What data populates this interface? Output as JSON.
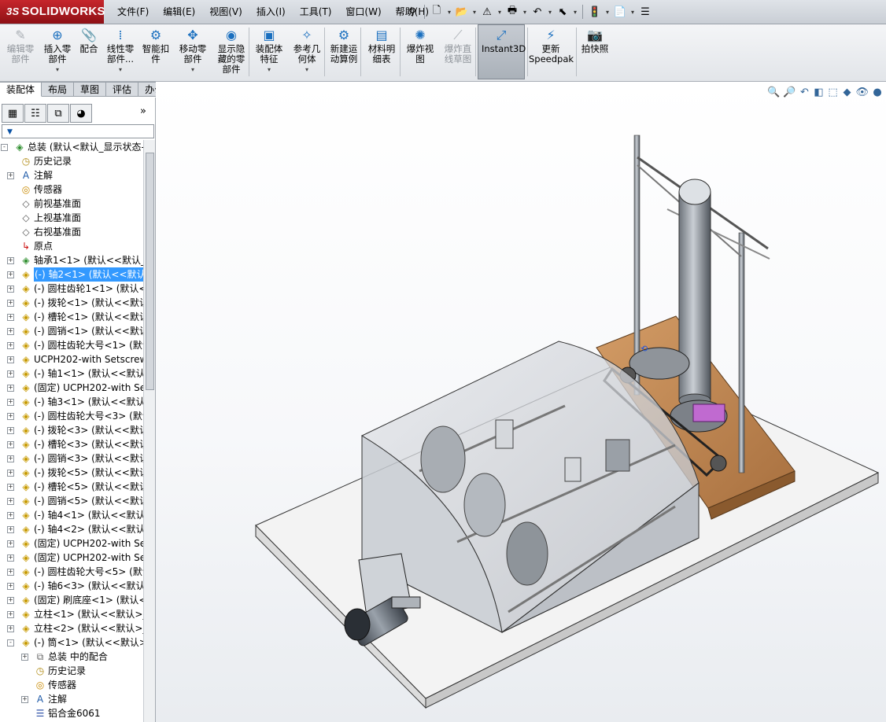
{
  "app": {
    "logo": "SOLIDWORKS",
    "logo_prefix": "3S"
  },
  "menu": [
    "文件(F)",
    "编辑(E)",
    "视图(V)",
    "插入(I)",
    "工具(T)",
    "窗口(W)",
    "帮助(H)"
  ],
  "quick_access": [
    {
      "name": "pin-icon",
      "glyph": "⚲"
    },
    {
      "name": "new-document-icon",
      "glyph": "🗋"
    },
    {
      "name": "open-folder-icon",
      "glyph": "📂"
    },
    {
      "name": "rebuild-icon",
      "glyph": "⚠"
    },
    {
      "name": "print-icon",
      "glyph": "🖶"
    },
    {
      "name": "undo-icon",
      "glyph": "↶"
    },
    {
      "name": "select-arrow-icon",
      "glyph": "⬉"
    },
    {
      "name": "traffic-light-icon",
      "glyph": "🚦"
    },
    {
      "name": "file-properties-icon",
      "glyph": "📄"
    },
    {
      "name": "options-icon",
      "glyph": "☰"
    }
  ],
  "toolbar": [
    {
      "label": "编辑零\n部件",
      "glyph": "✎",
      "disabled": true,
      "dropdown": false
    },
    {
      "label": "插入零\n部件",
      "glyph": "⊕",
      "disabled": false,
      "dropdown": true
    },
    {
      "label": "配合",
      "glyph": "📎",
      "disabled": false,
      "dropdown": false
    },
    {
      "label": "线性零\n部件...",
      "glyph": "⁞",
      "disabled": false,
      "dropdown": true
    },
    {
      "label": "智能扣\n件",
      "glyph": "⚙",
      "disabled": false,
      "dropdown": false
    },
    {
      "label": "移动零\n部件",
      "glyph": "✥",
      "disabled": false,
      "dropdown": true
    },
    {
      "label": "显示隐\n藏的零\n部件",
      "glyph": "◉",
      "disabled": false,
      "dropdown": false
    },
    {
      "label": "装配体\n特征",
      "glyph": "▣",
      "disabled": false,
      "dropdown": true
    },
    {
      "label": "参考几\n何体",
      "glyph": "✧",
      "disabled": false,
      "dropdown": true
    },
    {
      "label": "新建运\n动算例",
      "glyph": "⚙",
      "disabled": false,
      "dropdown": false
    },
    {
      "label": "材料明\n细表",
      "glyph": "▤",
      "disabled": false,
      "dropdown": false
    },
    {
      "label": "爆炸视\n图",
      "glyph": "✺",
      "disabled": false,
      "dropdown": false
    },
    {
      "label": "爆炸直\n线草图",
      "glyph": "⟋",
      "disabled": true,
      "dropdown": false
    },
    {
      "label": "Instant3D",
      "glyph": "⤢",
      "disabled": false,
      "dropdown": false
    },
    {
      "label": "更新\nSpeedpak",
      "glyph": "⚡",
      "disabled": false,
      "dropdown": false
    },
    {
      "label": "拍快照",
      "glyph": "📷",
      "disabled": false,
      "dropdown": false
    }
  ],
  "tabs": [
    "装配体",
    "布局",
    "草图",
    "评估",
    "办公室产品"
  ],
  "panel": {
    "expand_glyph": "»",
    "filter_glyph": "▼"
  },
  "tree": [
    {
      "text": "总装  (默认<默认_显示状态-1",
      "icon": "assembly",
      "level": 0,
      "toggle": "-"
    },
    {
      "text": "历史记录",
      "icon": "history",
      "level": 1,
      "toggle": ""
    },
    {
      "text": "注解",
      "icon": "annotation",
      "level": 1,
      "toggle": "+"
    },
    {
      "text": "传感器",
      "icon": "sensor",
      "level": 1,
      "toggle": ""
    },
    {
      "text": "前视基准面",
      "icon": "plane",
      "level": 1,
      "toggle": ""
    },
    {
      "text": "上视基准面",
      "icon": "plane",
      "level": 1,
      "toggle": ""
    },
    {
      "text": "右视基准面",
      "icon": "plane",
      "level": 1,
      "toggle": ""
    },
    {
      "text": "原点",
      "icon": "origin",
      "level": 1,
      "toggle": ""
    },
    {
      "text": "轴承1<1> (默认<<默认_显",
      "icon": "subasm",
      "level": 1,
      "toggle": "+"
    },
    {
      "text": "(-) 轴2<1> (默认<<默认>",
      "icon": "part",
      "level": 1,
      "toggle": "+",
      "selected": true
    },
    {
      "text": "(-) 圆柱齿轮1<1> (默认<",
      "icon": "part",
      "level": 1,
      "toggle": "+"
    },
    {
      "text": "(-) 拨轮<1> (默认<<默认",
      "icon": "part",
      "level": 1,
      "toggle": "+"
    },
    {
      "text": "(-) 槽轮<1> (默认<<默认",
      "icon": "part",
      "level": 1,
      "toggle": "+"
    },
    {
      "text": "(-) 圆销<1> (默认<<默认",
      "icon": "part",
      "level": 1,
      "toggle": "+"
    },
    {
      "text": "(-) 圆柱齿轮大号<1> (默认",
      "icon": "part",
      "level": 1,
      "toggle": "+"
    },
    {
      "text": "UCPH202-with Setscrew",
      "icon": "part",
      "level": 1,
      "toggle": "+"
    },
    {
      "text": "(-) 轴1<1> (默认<<默认",
      "icon": "part",
      "level": 1,
      "toggle": "+"
    },
    {
      "text": "(固定) UCPH202-with Set",
      "icon": "part",
      "level": 1,
      "toggle": "+"
    },
    {
      "text": "(-) 轴3<1> (默认<<默认",
      "icon": "part",
      "level": 1,
      "toggle": "+"
    },
    {
      "text": "(-) 圆柱齿轮大号<3> (默认",
      "icon": "part",
      "level": 1,
      "toggle": "+"
    },
    {
      "text": "(-) 拨轮<3> (默认<<默认",
      "icon": "part",
      "level": 1,
      "toggle": "+"
    },
    {
      "text": "(-) 槽轮<3> (默认<<默认",
      "icon": "part",
      "level": 1,
      "toggle": "+"
    },
    {
      "text": "(-) 圆销<3> (默认<<默认",
      "icon": "part",
      "level": 1,
      "toggle": "+"
    },
    {
      "text": "(-) 拨轮<5> (默认<<默认",
      "icon": "part",
      "level": 1,
      "toggle": "+"
    },
    {
      "text": "(-) 槽轮<5> (默认<<默认",
      "icon": "part",
      "level": 1,
      "toggle": "+"
    },
    {
      "text": "(-) 圆销<5> (默认<<默认",
      "icon": "part",
      "level": 1,
      "toggle": "+"
    },
    {
      "text": "(-) 轴4<1> (默认<<默认",
      "icon": "part",
      "level": 1,
      "toggle": "+"
    },
    {
      "text": "(-) 轴4<2> (默认<<默认",
      "icon": "part",
      "level": 1,
      "toggle": "+"
    },
    {
      "text": "(固定) UCPH202-with Set",
      "icon": "part",
      "level": 1,
      "toggle": "+"
    },
    {
      "text": "(固定) UCPH202-with Set",
      "icon": "part",
      "level": 1,
      "toggle": "+"
    },
    {
      "text": "(-) 圆柱齿轮大号<5> (默认",
      "icon": "part",
      "level": 1,
      "toggle": "+"
    },
    {
      "text": "(-) 轴6<3> (默认<<默认",
      "icon": "part",
      "level": 1,
      "toggle": "+"
    },
    {
      "text": "(固定) 刷底座<1> (默认<",
      "icon": "part",
      "level": 1,
      "toggle": "+"
    },
    {
      "text": "立柱<1> (默认<<默认>_",
      "icon": "part",
      "level": 1,
      "toggle": "+"
    },
    {
      "text": "立柱<2> (默认<<默认>_",
      "icon": "part",
      "level": 1,
      "toggle": "+"
    },
    {
      "text": "(-) 筒<1> (默认<<默认>_",
      "icon": "part",
      "level": 1,
      "toggle": "-"
    },
    {
      "text": "总装 中的配合",
      "icon": "mates",
      "level": 2,
      "toggle": "+"
    },
    {
      "text": "历史记录",
      "icon": "history",
      "level": 2,
      "toggle": ""
    },
    {
      "text": "传感器",
      "icon": "sensor",
      "level": 2,
      "toggle": ""
    },
    {
      "text": "注解",
      "icon": "annotation",
      "level": 2,
      "toggle": "+"
    },
    {
      "text": "铝合金6061",
      "icon": "material",
      "level": 2,
      "toggle": ""
    }
  ],
  "hud": [
    {
      "name": "zoom-to-fit-icon",
      "glyph": "🔍"
    },
    {
      "name": "zoom-to-area-icon",
      "glyph": "🔎"
    },
    {
      "name": "previous-view-icon",
      "glyph": "↶"
    },
    {
      "name": "section-view-icon",
      "glyph": "◧"
    },
    {
      "name": "view-orientation-icon",
      "glyph": "⬚"
    },
    {
      "name": "display-style-icon",
      "glyph": "◆"
    },
    {
      "name": "hide-show-items-icon",
      "glyph": "👁"
    },
    {
      "name": "edit-appearance-icon",
      "glyph": "●"
    }
  ],
  "colors": {
    "selection": "#3399ff",
    "logo": "#b51f25",
    "wood": "#b98553",
    "housing": "#c9ccd2"
  }
}
